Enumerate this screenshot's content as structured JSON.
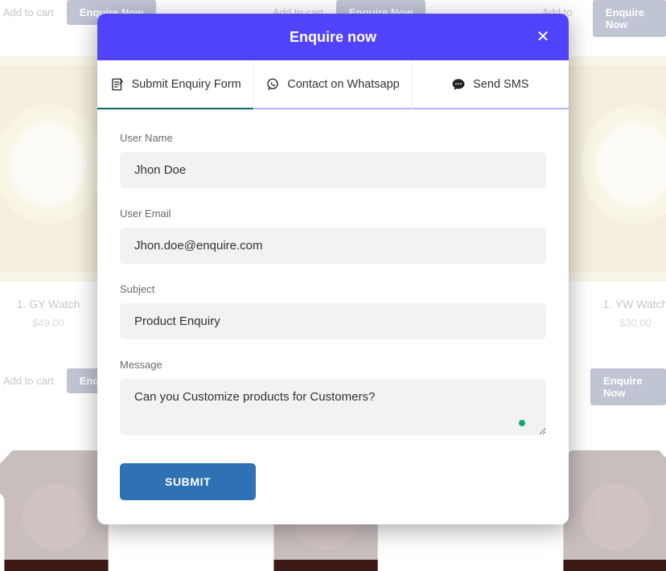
{
  "backdrop": {
    "add_to_cart": "Add to cart",
    "enquire_now": "Enquire Now",
    "products": {
      "left": {
        "name": "1. GY Watch",
        "price": "$49.00"
      },
      "right": {
        "name": "1. YW Watch",
        "price": "$30.00"
      }
    }
  },
  "modal": {
    "title": "Enquire now",
    "tabs": {
      "enquiry": "Submit Enquiry Form",
      "whatsapp": "Contact on Whatsapp",
      "sms": "Send SMS"
    },
    "form": {
      "username_label": "User Name",
      "username_value": "Jhon Doe",
      "email_label": "User Email",
      "email_value": "Jhon.doe@enquire.com",
      "subject_label": "Subject",
      "subject_value": "Product Enquiry",
      "message_label": "Message",
      "message_value": "Can you Customize products for Customers?",
      "submit_label": "SUBMIT"
    }
  }
}
